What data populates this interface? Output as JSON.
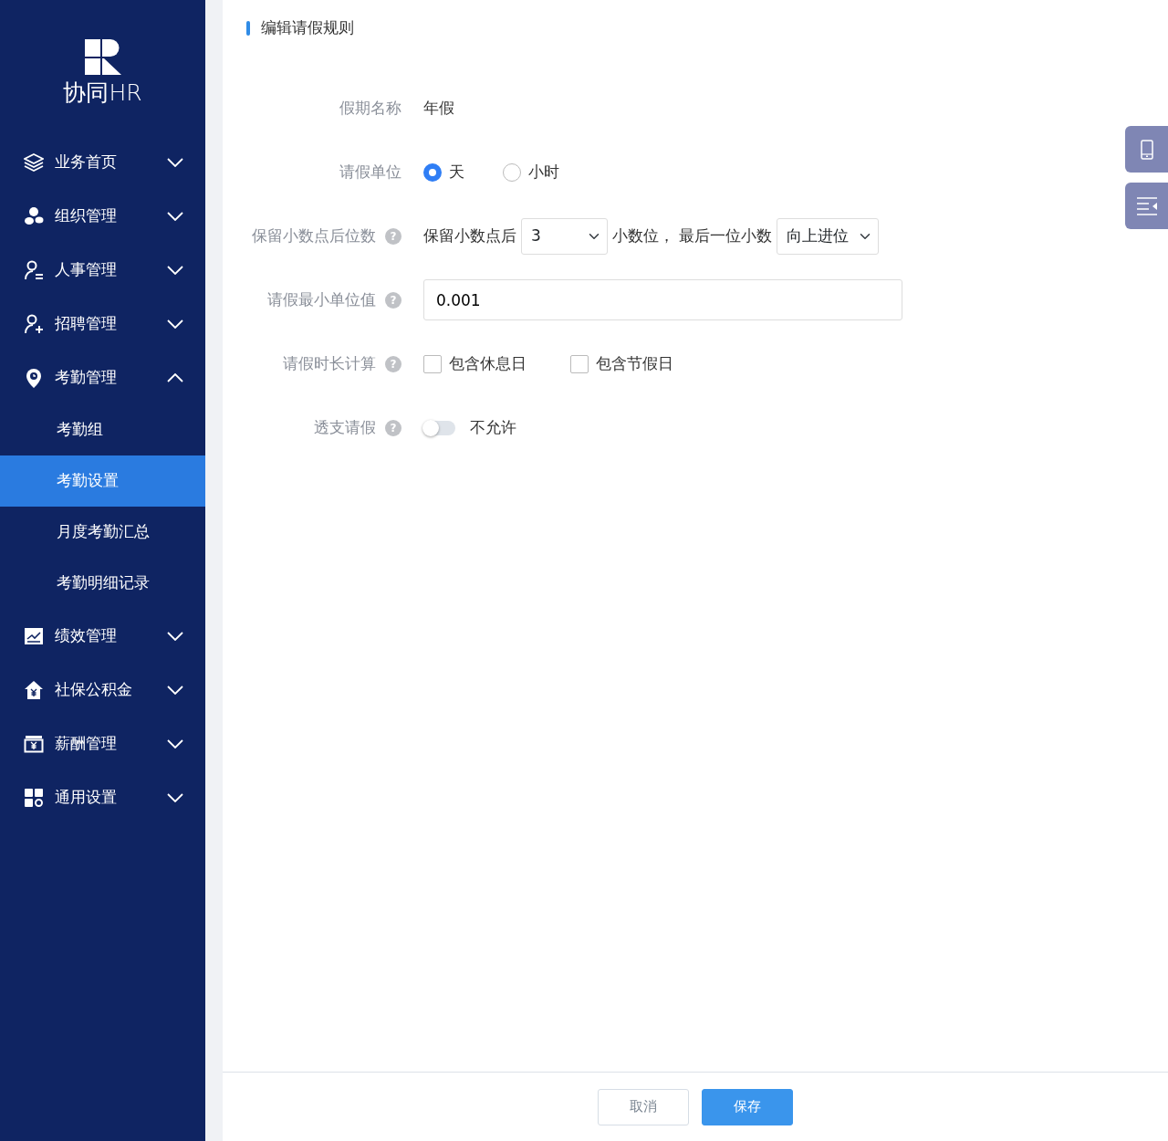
{
  "sidebar": {
    "logo_text": "协同HR",
    "items": [
      {
        "label": "业务首页",
        "kind": "layers",
        "expanded": false
      },
      {
        "label": "组织管理",
        "kind": "org",
        "expanded": false
      },
      {
        "label": "人事管理",
        "kind": "person-list",
        "expanded": false
      },
      {
        "label": "招聘管理",
        "kind": "person-add",
        "expanded": false
      },
      {
        "label": "考勤管理",
        "kind": "pin",
        "expanded": true,
        "children": [
          {
            "label": "考勤组",
            "selected": false
          },
          {
            "label": "考勤设置",
            "selected": true
          },
          {
            "label": "月度考勤汇总",
            "selected": false
          },
          {
            "label": "考勤明细记录",
            "selected": false
          }
        ]
      },
      {
        "label": "绩效管理",
        "kind": "chart",
        "expanded": false
      },
      {
        "label": "社保公积金",
        "kind": "house",
        "expanded": false
      },
      {
        "label": "薪酬管理",
        "kind": "wallet",
        "expanded": false
      },
      {
        "label": "通用设置",
        "kind": "grid",
        "expanded": false
      }
    ]
  },
  "page": {
    "title": "编辑请假规则"
  },
  "form": {
    "rows": [
      {
        "kind": "text",
        "label": "假期名称",
        "value": "年假"
      },
      {
        "kind": "radio",
        "label": "请假单位",
        "options": [
          {
            "label": "天",
            "selected": true
          },
          {
            "label": "小时",
            "selected": false
          }
        ]
      },
      {
        "kind": "decimal",
        "label": "保留小数点后位数",
        "help": "?",
        "prefix": "保留小数点后",
        "digits": "3",
        "middle": "小数位，",
        "suffix": "最后一位小数",
        "rounding": "向上进位"
      },
      {
        "kind": "input",
        "label": "请假最小单位值",
        "help": "?",
        "value": "0.001"
      },
      {
        "kind": "checkbox",
        "label": "请假时长计算",
        "help": "?",
        "options": [
          {
            "label": "包含休息日",
            "checked": false
          },
          {
            "label": "包含节假日",
            "checked": false
          }
        ]
      },
      {
        "kind": "switch",
        "label": "透支请假",
        "help": "?",
        "on": false,
        "state_text": "不允许"
      }
    ]
  },
  "footer": {
    "buttons": [
      {
        "label": "取消",
        "kind": "secondary"
      },
      {
        "label": "保存",
        "kind": "primary"
      }
    ]
  }
}
